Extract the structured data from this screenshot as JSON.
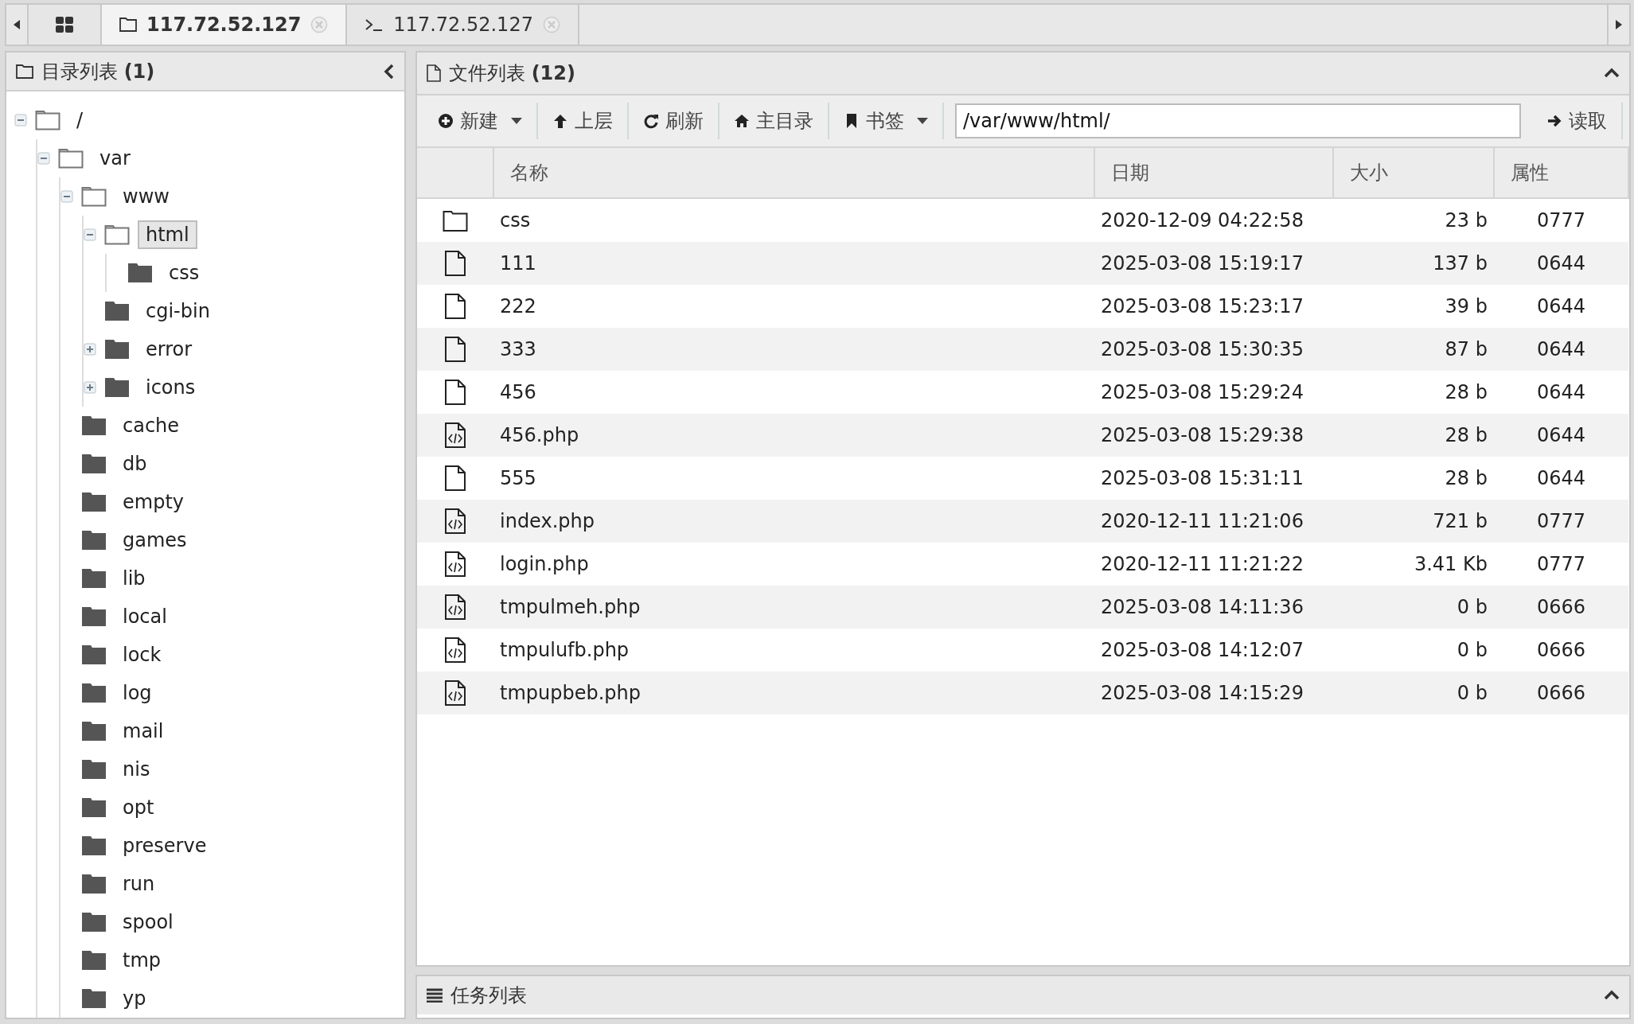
{
  "tabs": [
    {
      "kind": "home",
      "selected": false
    },
    {
      "kind": "files",
      "label": "117.72.52.127",
      "selected": true
    },
    {
      "kind": "terminal",
      "label": "117.72.52.127",
      "selected": false
    }
  ],
  "directory_panel": {
    "title": "目录列表",
    "count": "(1)",
    "tree": [
      {
        "name": "/",
        "expanded": true,
        "selected": false,
        "children": [
          {
            "name": "var",
            "expanded": true,
            "selected": false,
            "children": [
              {
                "name": "www",
                "expanded": true,
                "selected": false,
                "children": [
                  {
                    "name": "html",
                    "expanded": true,
                    "selected": true,
                    "children": [
                      {
                        "name": "css",
                        "selected": false
                      }
                    ]
                  },
                  {
                    "name": "cgi-bin",
                    "selected": false
                  },
                  {
                    "name": "error",
                    "expanded": false,
                    "selected": false
                  },
                  {
                    "name": "icons",
                    "expanded": false,
                    "selected": false
                  }
                ]
              },
              {
                "name": "cache",
                "selected": false
              },
              {
                "name": "db",
                "selected": false
              },
              {
                "name": "empty",
                "selected": false
              },
              {
                "name": "games",
                "selected": false
              },
              {
                "name": "lib",
                "selected": false
              },
              {
                "name": "local",
                "selected": false
              },
              {
                "name": "lock",
                "selected": false
              },
              {
                "name": "log",
                "selected": false
              },
              {
                "name": "mail",
                "selected": false
              },
              {
                "name": "nis",
                "selected": false
              },
              {
                "name": "opt",
                "selected": false
              },
              {
                "name": "preserve",
                "selected": false
              },
              {
                "name": "run",
                "selected": false
              },
              {
                "name": "spool",
                "selected": false
              },
              {
                "name": "tmp",
                "selected": false
              },
              {
                "name": "yp",
                "selected": false
              }
            ]
          }
        ]
      }
    ]
  },
  "file_panel": {
    "title": "文件列表",
    "count": "(12)",
    "toolbar": [
      {
        "kind": "new",
        "label": "新建",
        "has_menu": true
      },
      {
        "kind": "up",
        "label": "上层",
        "has_menu": false
      },
      {
        "kind": "refresh",
        "label": "刷新",
        "has_menu": false
      },
      {
        "kind": "home",
        "label": "主目录",
        "has_menu": false
      },
      {
        "kind": "bookmark",
        "label": "书签",
        "has_menu": true
      }
    ],
    "path": "/var/www/html/",
    "read_button": "读取",
    "columns": [
      "名称",
      "日期",
      "大小",
      "属性"
    ],
    "rows": [
      {
        "kind": "folder",
        "name": "css",
        "date": "2020-12-09 04:22:58",
        "size": "23 b",
        "mode": "0777"
      },
      {
        "kind": "file",
        "name": "111",
        "date": "2025-03-08 15:19:17",
        "size": "137 b",
        "mode": "0644"
      },
      {
        "kind": "file",
        "name": "222",
        "date": "2025-03-08 15:23:17",
        "size": "39 b",
        "mode": "0644"
      },
      {
        "kind": "file",
        "name": "333",
        "date": "2025-03-08 15:30:35",
        "size": "87 b",
        "mode": "0644"
      },
      {
        "kind": "file",
        "name": "456",
        "date": "2025-03-08 15:29:24",
        "size": "28 b",
        "mode": "0644"
      },
      {
        "kind": "code",
        "name": "456.php",
        "date": "2025-03-08 15:29:38",
        "size": "28 b",
        "mode": "0644"
      },
      {
        "kind": "file",
        "name": "555",
        "date": "2025-03-08 15:31:11",
        "size": "28 b",
        "mode": "0644"
      },
      {
        "kind": "code",
        "name": "index.php",
        "date": "2020-12-11 11:21:06",
        "size": "721 b",
        "mode": "0777"
      },
      {
        "kind": "code",
        "name": "login.php",
        "date": "2020-12-11 11:21:22",
        "size": "3.41 Kb",
        "mode": "0777"
      },
      {
        "kind": "code",
        "name": "tmpulmeh.php",
        "date": "2025-03-08 14:11:36",
        "size": "0 b",
        "mode": "0666"
      },
      {
        "kind": "code",
        "name": "tmpulufb.php",
        "date": "2025-03-08 14:12:07",
        "size": "0 b",
        "mode": "0666"
      },
      {
        "kind": "code",
        "name": "tmpupbeb.php",
        "date": "2025-03-08 14:15:29",
        "size": "0 b",
        "mode": "0666"
      }
    ]
  },
  "task_panel": {
    "title": "任务列表"
  }
}
